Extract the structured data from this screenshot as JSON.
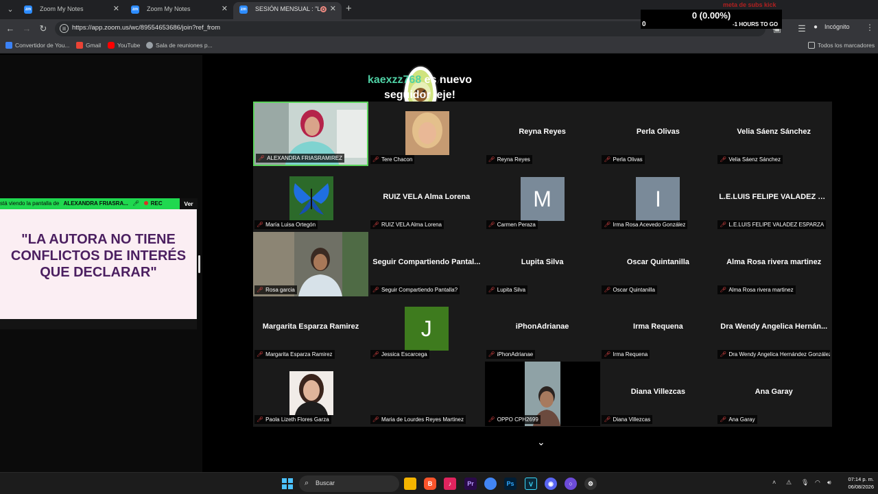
{
  "browser": {
    "tabs": [
      {
        "title": "Zoom My Notes",
        "active": false
      },
      {
        "title": "Zoom My Notes",
        "active": false
      },
      {
        "title": "SESIÓN MENSUAL : \"Lactan",
        "active": true
      }
    ],
    "url": "https://app.zoom.us/wc/89554653686/join?ref_from",
    "profile_label": "Incógnito",
    "bookmarks": [
      "Convertidor de You...",
      "Gmail",
      "YouTube",
      "Sala de reuniones p..."
    ],
    "bookmarks_folder": "Todos los marcadores"
  },
  "overlay": {
    "follower_user": "kaexzz768",
    "follower_line1": " es nuevo",
    "follower_line2": "seguidor jeje!",
    "subs_title": "meta de subs kick",
    "subs_value": "0 (0.00%)",
    "subs_left": "0",
    "subs_mid": "-1 HOURS TO GO"
  },
  "share": {
    "banner_prefix": "stá viendo la pantalla de",
    "banner_name": "ALEXANDRA FRIASRA...",
    "rec_label": "REC",
    "view_button": "Ver",
    "slide_text": "\"LA AUTORA NO TIENE CONFLICTOS DE INTERÉS QUE DECLARAR\""
  },
  "participants": [
    {
      "tile": "",
      "label": "ALEXANDRA FRIASRAMIREZ",
      "kind": "video-woman-red"
    },
    {
      "tile": "",
      "label": "Tere Chacon",
      "kind": "photo-blonde"
    },
    {
      "tile": "Reyna Reyes",
      "label": "Reyna Reyes",
      "kind": "name"
    },
    {
      "tile": "Perla Olivas",
      "label": "Perla Olivas",
      "kind": "name"
    },
    {
      "tile": "Velia Sáenz Sánchez",
      "label": "Velia Sáenz Sánchez",
      "kind": "name"
    },
    {
      "tile": "",
      "label": "María Luisa Ortegón",
      "kind": "photo-butterfly"
    },
    {
      "tile": "RUIZ VELA Alma Lorena",
      "label": "RUIZ VELA Alma Lorena",
      "kind": "name"
    },
    {
      "tile": "M",
      "label": "Carmen Peraza",
      "kind": "letter-gray"
    },
    {
      "tile": "I",
      "label": "Irma Rosa Acevedo González",
      "kind": "letter-gray"
    },
    {
      "tile": "L.E.LUIS FELIPE VALADEZ ES...",
      "label": "L.E.LUIS FELIPE VALADEZ ESPARZA",
      "kind": "name"
    },
    {
      "tile": "",
      "label": "Rosa garcia",
      "kind": "video-woman-room"
    },
    {
      "tile": "Seguir Compartiendo Pantal...",
      "label": "Seguir Compartiendo Pantalla?",
      "kind": "name"
    },
    {
      "tile": "Lupita Silva",
      "label": "Lupita Silva",
      "kind": "name"
    },
    {
      "tile": "Oscar Quintanilla",
      "label": "Oscar Quintanilla",
      "kind": "name"
    },
    {
      "tile": "Alma Rosa rivera martinez",
      "label": "Alma Rosa rivera martinez",
      "kind": "name"
    },
    {
      "tile": "Margarita Esparza Ramirez",
      "label": "Margarita Esparza Ramirez",
      "kind": "name"
    },
    {
      "tile": "J",
      "label": "Jessica Escarcega",
      "kind": "letter-green"
    },
    {
      "tile": "iPhonAdrianae",
      "label": "iPhonAdrianae",
      "kind": "name"
    },
    {
      "tile": "Irma Requena",
      "label": "Irma Requena",
      "kind": "name"
    },
    {
      "tile": "Dra Wendy Angelica Hernán...",
      "label": "Dra Wendy Angelica Hernández González",
      "kind": "name"
    },
    {
      "tile": "",
      "label": "Paola Lizeth Flores Garza",
      "kind": "photo-woman"
    },
    {
      "tile": "",
      "label": "Maria de Lourdes Reyes Martinez",
      "kind": "blank"
    },
    {
      "tile": "",
      "label": "OPPO CPH2699",
      "kind": "video-phone"
    },
    {
      "tile": "Diana Villezcas",
      "label": "Diana Villezcas",
      "kind": "name"
    },
    {
      "tile": "Ana Garay",
      "label": "Ana Garay",
      "kind": "name"
    }
  ],
  "taskbar": {
    "search_label": "Buscar",
    "time": "07:14 p. m.",
    "date": "06/08/2026"
  },
  "colors": {
    "accent_green": "#1fd84f",
    "follower_user": "#4fd1a5",
    "slide_text": "#4b1f60",
    "mute_red": "#ff4d4d"
  }
}
